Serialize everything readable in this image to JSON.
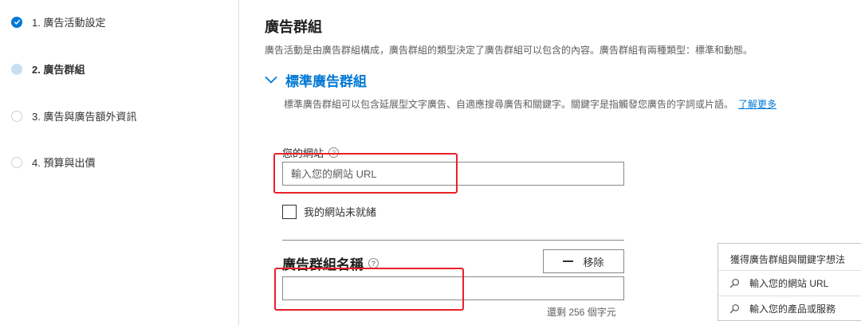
{
  "steps": [
    {
      "label": "1. 廣告活動設定",
      "state": "done"
    },
    {
      "label": "2. 廣告群組",
      "state": "current"
    },
    {
      "label": "3. 廣告與廣告額外資訊",
      "state": "todo"
    },
    {
      "label": "4. 預算與出價",
      "state": "todo"
    }
  ],
  "main": {
    "title": "廣告群組",
    "description": "廣告活動是由廣告群組構成，廣告群組的類型決定了廣告群組可以包含的內容。廣告群組有兩種類型：標準和動態。",
    "section": {
      "title": "標準廣告群組",
      "description": "標準廣告群組可以包含延展型文字廣告、自適應搜尋廣告和關鍵字。關鍵字是指觸發您廣告的字詞或片語。",
      "learn_more": "了解更多"
    },
    "website": {
      "label": "您的網站",
      "placeholder": "輸入您的網站 URL",
      "not_ready_label": "我的網站未就緒"
    },
    "ad_group_name": {
      "label": "廣告群組名稱",
      "remove_label": "移除",
      "value": "",
      "remaining": "還剩 256 個字元"
    }
  },
  "ideas_panel": {
    "title": "獲得廣告群組與關鍵字想法",
    "items": [
      "輸入您的網站 URL",
      "輸入您的產品或服務"
    ]
  },
  "colors": {
    "accent": "#0078d4",
    "highlight": "#e8202a"
  }
}
